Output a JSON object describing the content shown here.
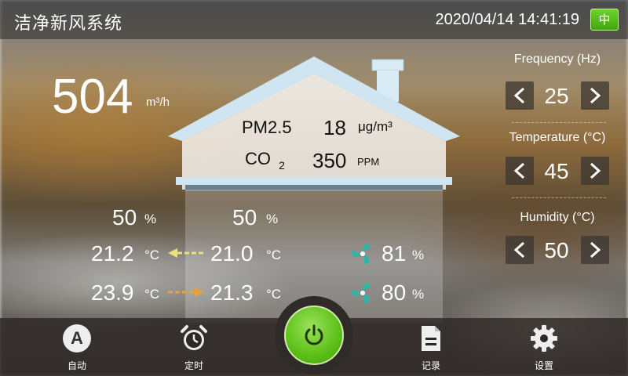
{
  "header": {
    "title": "洁净新风系统",
    "datetime": "2020/04/14 14:41:19",
    "mode_badge": "中"
  },
  "airflow": {
    "value": "504",
    "unit": "m³/h"
  },
  "house": {
    "pm25_label": "PM2.5",
    "pm25_value": "18",
    "pm25_unit": "μg/m³",
    "co2_label": "CO",
    "co2_sub": "2",
    "co2_value": "350",
    "co2_unit": "PPM"
  },
  "readings": {
    "outdoor_humidity": "50",
    "outdoor_humidity_unit": "%",
    "indoor_humidity": "50",
    "indoor_humidity_unit": "%",
    "outdoor_temp_1": "21.2",
    "indoor_temp_1": "21.0",
    "outdoor_temp_2": "23.9",
    "indoor_temp_2": "21.3",
    "temp_unit": "°C",
    "fan_1_value": "81",
    "fan_2_value": "80",
    "fan_unit": "%"
  },
  "controls": {
    "frequency": {
      "label": "Frequency (Hz)",
      "value": "25"
    },
    "temperature": {
      "label": "Temperature  (°C)",
      "value": "45"
    },
    "humidity": {
      "label": "Humidity  (°C)",
      "value": "50"
    }
  },
  "nav": {
    "auto_label": "自动",
    "auto_letter": "A",
    "timer_label": "定时",
    "record_label": "记录",
    "settings_label": "设置"
  },
  "colors": {
    "accent_green": "#5cbf17",
    "arrow_yellow": "#e8e27a",
    "arrow_orange": "#e6a23c",
    "fan_teal": "#2bb6a8"
  }
}
